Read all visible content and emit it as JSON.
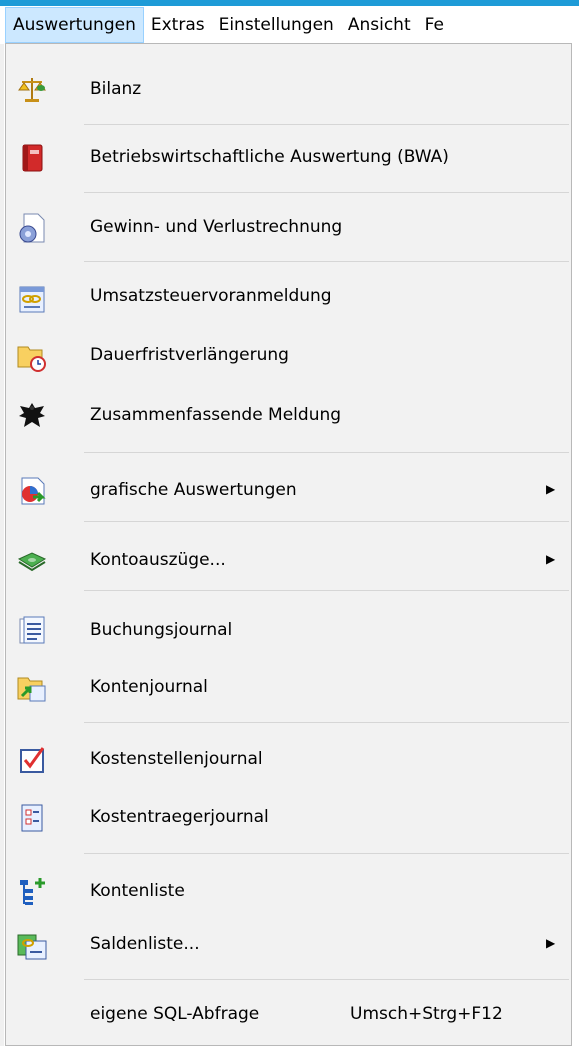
{
  "menubar": {
    "items": [
      {
        "label": "Auswertungen"
      },
      {
        "label": "Extras"
      },
      {
        "label": "Einstellungen"
      },
      {
        "label": "Ansicht"
      },
      {
        "label": "Fe"
      }
    ]
  },
  "menu": {
    "items": [
      {
        "label": "Bilanz",
        "icon": "scales-icon"
      },
      {
        "label": "Betriebswirtschaftliche Auswertung (BWA)",
        "icon": "red-book-icon"
      },
      {
        "label": "Gewinn- und Verlustrechnung",
        "icon": "document-disc-icon"
      },
      {
        "label": "Umsatzsteuervoranmeldung",
        "icon": "document-chain-icon"
      },
      {
        "label": "Dauerfristverlängerung",
        "icon": "folder-clock-icon"
      },
      {
        "label": "Zusammenfassende Meldung",
        "icon": "federal-eagle-icon"
      },
      {
        "label": "grafische Auswertungen",
        "icon": "chart-arrow-icon",
        "submenu_glyph": "▶"
      },
      {
        "label": "Kontoauszüge...",
        "icon": "money-bundle-icon",
        "submenu_glyph": "▶"
      },
      {
        "label": "Buchungsjournal",
        "icon": "journal-pages-icon"
      },
      {
        "label": "Kontenjournal",
        "icon": "folder-arrow-icon"
      },
      {
        "label": "Kostenstellenjournal",
        "icon": "checkbox-icon"
      },
      {
        "label": "Kostentraegerjournal",
        "icon": "form-document-icon"
      },
      {
        "label": "Kontenliste",
        "icon": "tree-plus-icon"
      },
      {
        "label": "Saldenliste...",
        "icon": "chain-list-icon",
        "submenu_glyph": "▶"
      },
      {
        "label": "eigene SQL-Abfrage",
        "shortcut": "Umsch+Strg+F12"
      }
    ]
  },
  "colors": {
    "accent": "#1e9bd7",
    "menubar_highlight": "#cce8ff",
    "menu_bg": "#f2f2f2"
  }
}
